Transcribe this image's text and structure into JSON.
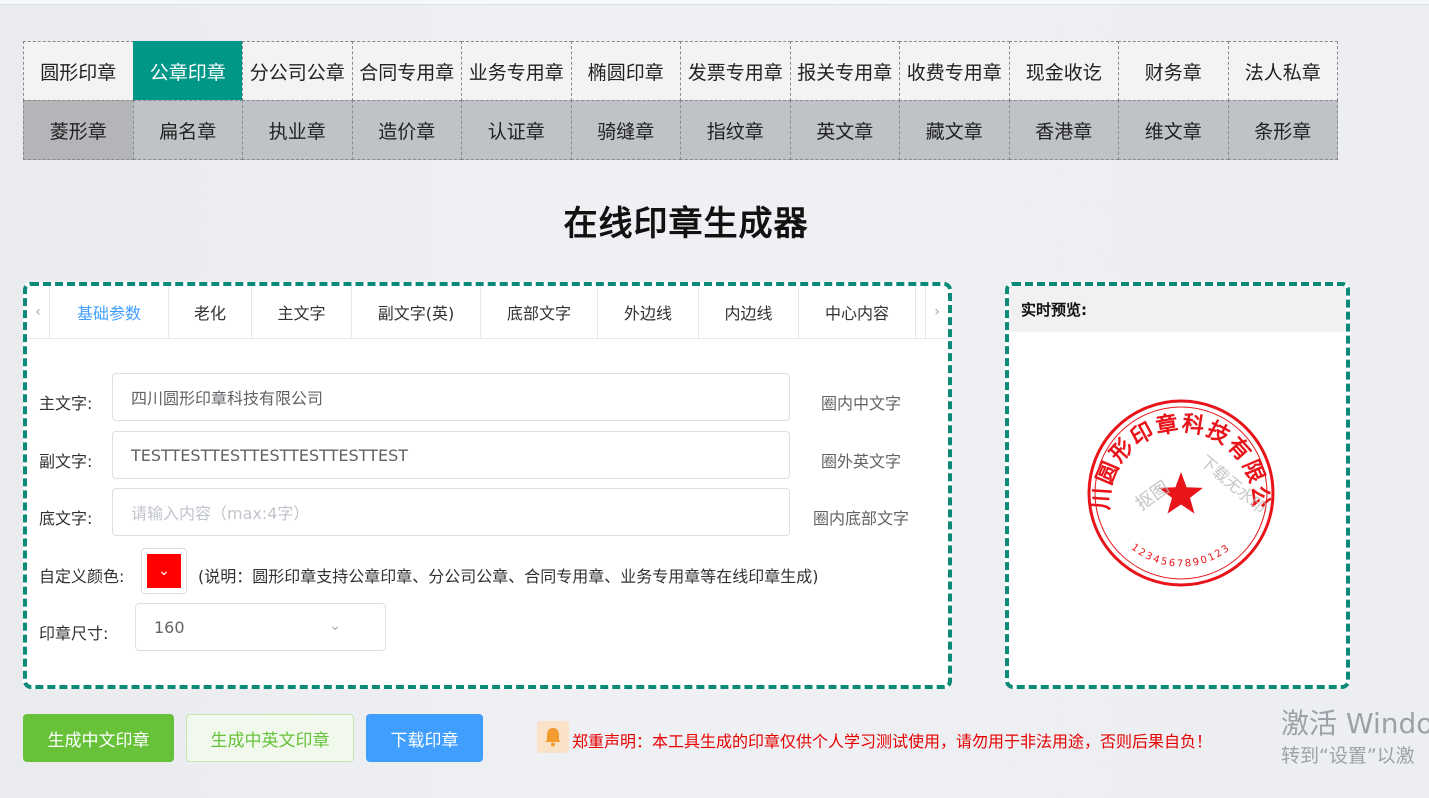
{
  "stamp_types": {
    "row1": [
      "圆形印章",
      "公章印章",
      "分公司公章",
      "合同专用章",
      "业务专用章",
      "椭圆印章",
      "发票专用章",
      "报关专用章",
      "收费专用章",
      "现金收讫",
      "财务章",
      "法人私章"
    ],
    "row2": [
      "菱形章",
      "扁名章",
      "执业章",
      "造价章",
      "认证章",
      "骑缝章",
      "指纹章",
      "英文章",
      "藏文章",
      "香港章",
      "维文章",
      "条形章"
    ],
    "active": "公章印章"
  },
  "page_title": "在线印章生成器",
  "tabs": {
    "left_arrow": "‹",
    "right_arrow": "›",
    "items": [
      "基础参数",
      "老化",
      "主文字",
      "副文字(英)",
      "底部文字",
      "外边线",
      "内边线",
      "中心内容"
    ],
    "active": "基础参数"
  },
  "form": {
    "main_text": {
      "label": "主文字:",
      "value": "四川圆形印章科技有限公司",
      "hint": "圈内中文字"
    },
    "sub_text": {
      "label": "副文字:",
      "value": "TESTTESTTESTTESTTESTTESTTEST",
      "hint": "圈外英文字"
    },
    "bottom_text": {
      "label": "底文字:",
      "placeholder": "请输入内容（max:4字）",
      "hint": "圈内底部文字"
    },
    "color": {
      "label": "自定义颜色:",
      "value": "#ff0000",
      "note": "(说明：圆形印章支持公章印章、分公司公章、合同专用章、业务专用章等在线印章生成)"
    },
    "size": {
      "label": "印章尺寸:",
      "value": "160"
    }
  },
  "preview": {
    "title": "实时预览:",
    "stamp": {
      "color": "#e8141a",
      "main_text": "四川圆形印章科技有限公司",
      "code": "1234567890123",
      "watermark": [
        "抠图",
        "下载无水印"
      ]
    }
  },
  "buttons": {
    "gen_cn": "生成中文印章",
    "gen_cn_en": "生成中英文印章",
    "download": "下载印章"
  },
  "notice": "郑重声明：本工具生成的印章仅供个人学习测试使用，请勿用于非法用途，否则后果自负！",
  "windows_watermark": {
    "line1": "激活 Windo",
    "line2": "转到“设置”以激"
  }
}
